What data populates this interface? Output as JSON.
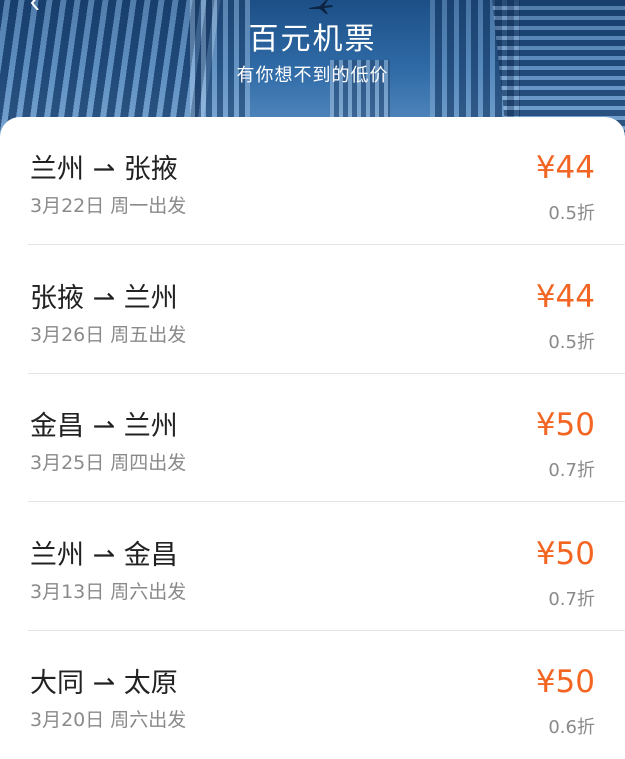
{
  "header": {
    "title": "百元机票",
    "subtitle": "有你想不到的低价"
  },
  "colors": {
    "price": "#f26522",
    "banner": "#2f6aa6"
  },
  "icons": {
    "back": "back-arrow-icon",
    "plane": "airplane-icon"
  },
  "flights": [
    {
      "route": "兰州 ⇀ 张掖",
      "date": "3月22日  周一出发",
      "price": "¥44",
      "discount": "0.5折"
    },
    {
      "route": "张掖 ⇀ 兰州",
      "date": "3月26日  周五出发",
      "price": "¥44",
      "discount": "0.5折"
    },
    {
      "route": "金昌 ⇀ 兰州",
      "date": "3月25日  周四出发",
      "price": "¥50",
      "discount": "0.7折"
    },
    {
      "route": "兰州 ⇀ 金昌",
      "date": "3月13日  周六出发",
      "price": "¥50",
      "discount": "0.7折"
    },
    {
      "route": "大同 ⇀ 太原",
      "date": "3月20日  周六出发",
      "price": "¥50",
      "discount": "0.6折"
    }
  ]
}
